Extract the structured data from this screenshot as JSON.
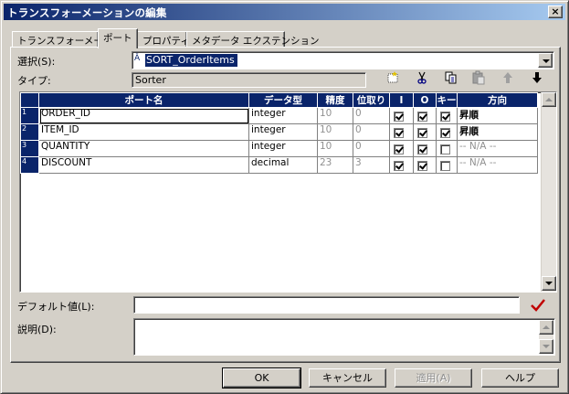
{
  "window": {
    "title": "トランスフォーメーションの編集",
    "close_label": "×"
  },
  "tabs": [
    {
      "label": "トランスフォーメーション",
      "active": false
    },
    {
      "label": "ポート",
      "active": true
    },
    {
      "label": "プロパティ",
      "active": false
    },
    {
      "label": "メタデータ エクステンション",
      "active": false
    }
  ],
  "select": {
    "label": "選択(S):",
    "value": "SORT_OrderItems",
    "icon": "sorter-icon"
  },
  "type": {
    "label": "タイプ:",
    "value": "Sorter"
  },
  "toolbar": {
    "icons": [
      "new-port-icon",
      "cut-icon",
      "copy-icon",
      "paste-icon",
      "move-up-icon",
      "move-down-icon"
    ]
  },
  "ports": {
    "columns": [
      "ポート名",
      "データ型",
      "精度",
      "位取り",
      "I",
      "O",
      "キー",
      "方向"
    ],
    "rows": [
      {
        "num": "1",
        "name": "ORDER_ID",
        "datatype": "integer",
        "precision": "10",
        "scale": "0",
        "input": true,
        "output": true,
        "key": true,
        "direction": "昇順"
      },
      {
        "num": "2",
        "name": "ITEM_ID",
        "datatype": "integer",
        "precision": "10",
        "scale": "0",
        "input": true,
        "output": true,
        "key": true,
        "direction": "昇順"
      },
      {
        "num": "3",
        "name": "QUANTITY",
        "datatype": "integer",
        "precision": "10",
        "scale": "0",
        "input": true,
        "output": true,
        "key": false,
        "direction": "-- N/A --"
      },
      {
        "num": "4",
        "name": "DISCOUNT",
        "datatype": "decimal",
        "precision": "23",
        "scale": "3",
        "input": true,
        "output": true,
        "key": false,
        "direction": "-- N/A --"
      }
    ]
  },
  "default_value": {
    "label": "デフォルト値(L):",
    "value": ""
  },
  "description": {
    "label": "説明(D):",
    "value": ""
  },
  "buttons": {
    "ok": "OK",
    "cancel": "キャンセル",
    "apply": "適用(A)",
    "help": "ヘルプ"
  },
  "colors": {
    "title_start": "#0a246a",
    "title_end": "#a6caf0",
    "selection": "#0a246a",
    "face": "#d4d0c8",
    "validate_check": "#c00000"
  }
}
